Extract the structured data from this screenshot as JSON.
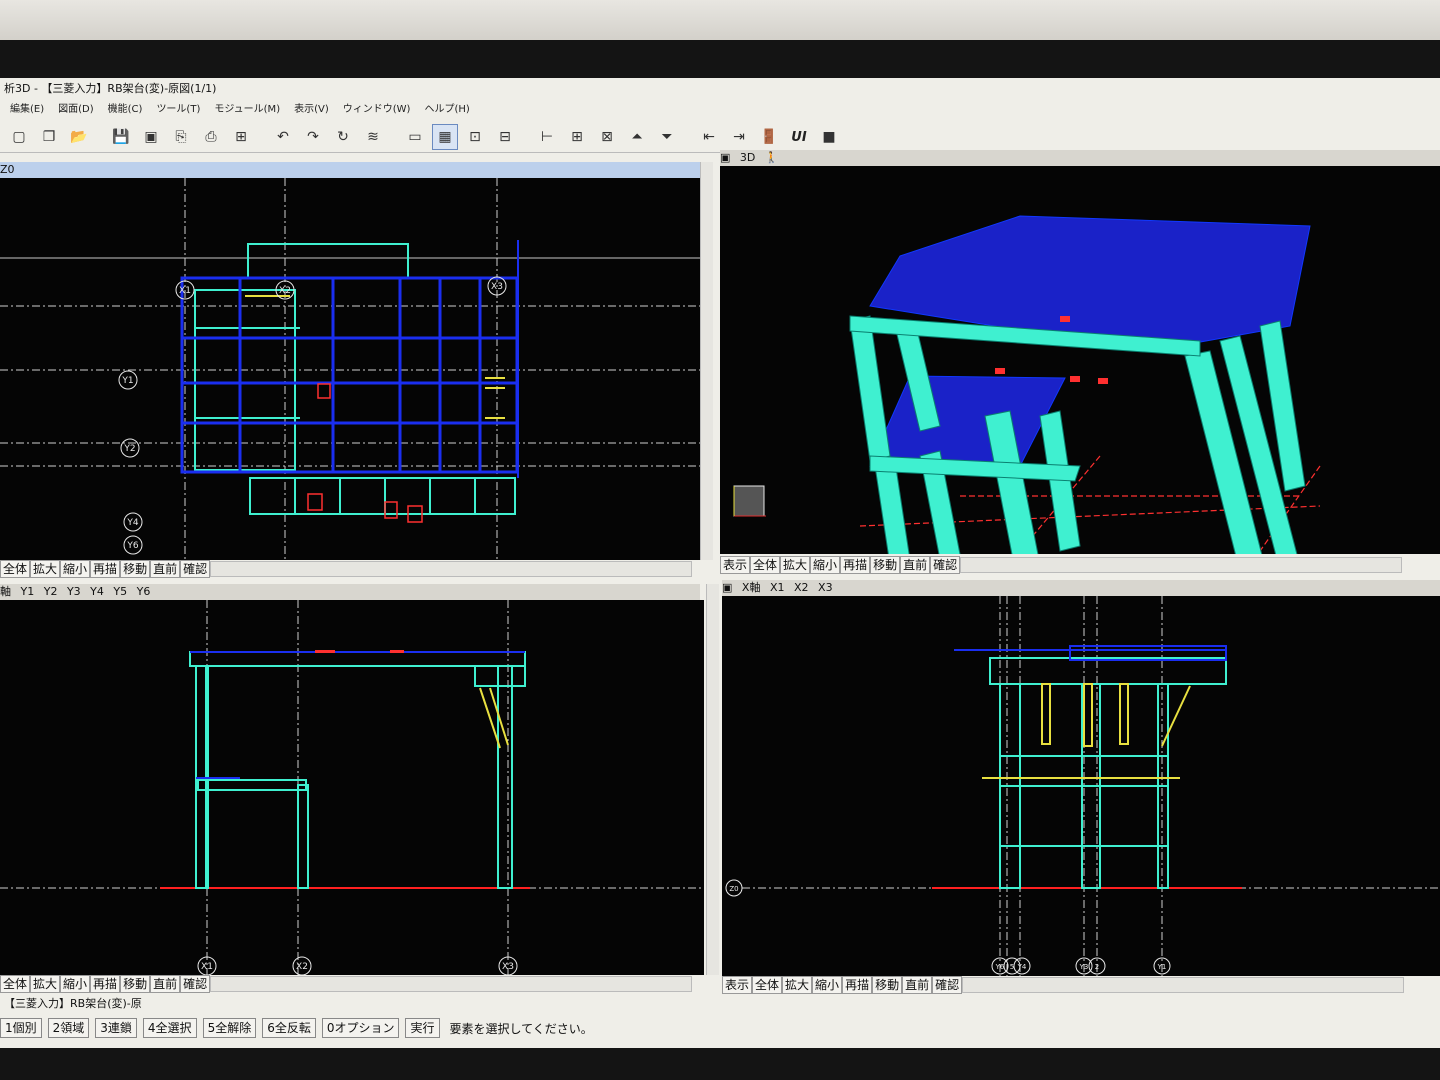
{
  "window": {
    "title": "析3D - 【三菱入力】RB架台(変)-原図(1/1)"
  },
  "menu": [
    "編集(E)",
    "図面(D)",
    "機能(C)",
    "ツール(T)",
    "モジュール(M)",
    "表示(V)",
    "ウィンドウ(W)",
    "ヘルプ(H)"
  ],
  "toolbar": {
    "ui_label": "UI"
  },
  "pane_plan": {
    "title": "Z0",
    "x_grid": [
      "X1",
      "X2",
      "X3"
    ],
    "y_grid": [
      "Y1",
      "Y2",
      "Y4",
      "Y6"
    ]
  },
  "pane_3d": {
    "title": "3D"
  },
  "pane_elev_y": {
    "title": "軸",
    "tabs": [
      "Y1",
      "Y2",
      "Y3",
      "Y4",
      "Y5",
      "Y6"
    ],
    "x_grid": [
      "X1",
      "X2",
      "X3"
    ]
  },
  "pane_elev_x": {
    "title": "X軸",
    "tabs": [
      "X1",
      "X2",
      "X3"
    ],
    "y_grid": [
      "Y6",
      "5",
      "Y4",
      "Y3",
      "2",
      "Y1"
    ],
    "level": "Z0"
  },
  "nav_buttons": [
    "全体",
    "拡大",
    "縮小",
    "再描",
    "移動",
    "直前",
    "確認"
  ],
  "nav_buttons_3d": [
    "表示",
    "全体",
    "拡大",
    "縮小",
    "再描",
    "移動",
    "直前",
    "確認"
  ],
  "status": {
    "doc": "【三菱入力】RB架台(変)-原",
    "buttons": [
      "1個別",
      "2領域",
      "3連鎖",
      "4全選択",
      "5全解除",
      "6全反転",
      "0オプション",
      "実行"
    ],
    "prompt": "要素を選択してください。"
  },
  "colors": {
    "cyan": "#3ff0d0",
    "blue": "#1a2ef0",
    "red": "#ff2020",
    "yellow": "#e8e040",
    "grid": "#d0d0d0"
  }
}
